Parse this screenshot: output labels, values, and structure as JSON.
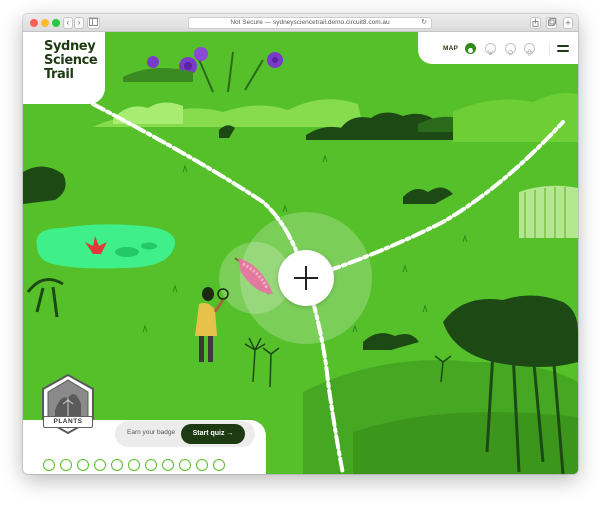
{
  "browser": {
    "url": "Not Secure — sydneysciencetrail.demo.circuit8.com.au",
    "reload_icon": "↻",
    "back_icon": "‹",
    "forward_icon": "›",
    "sidebar_icon": "sidebar-icon",
    "share_icon": "share-icon",
    "tabs_icon": "tabs-icon",
    "new_tab_icon": "+"
  },
  "logo": {
    "lines": [
      "Sydney",
      "Science",
      "Trail"
    ]
  },
  "nav": {
    "map_label": "MAP",
    "icons": [
      "flower-icon",
      "paw-icon",
      "rock-icon",
      "atom-icon",
      "robot-icon"
    ],
    "menu_icon": "hamburger-menu-icon"
  },
  "map": {
    "add_icon": "plus-icon",
    "featured_item": "callistemon-flower"
  },
  "badge": {
    "label": "PLANTS"
  },
  "quiz": {
    "earn_text": "Earn your badge",
    "button_label": "Start quiz →"
  },
  "progress": {
    "total": 11,
    "completed": 0
  },
  "colors": {
    "grass": "#56c02a",
    "dark_green": "#1d3a12",
    "light_green": "#8ee04e",
    "water": "#3ff08a"
  }
}
